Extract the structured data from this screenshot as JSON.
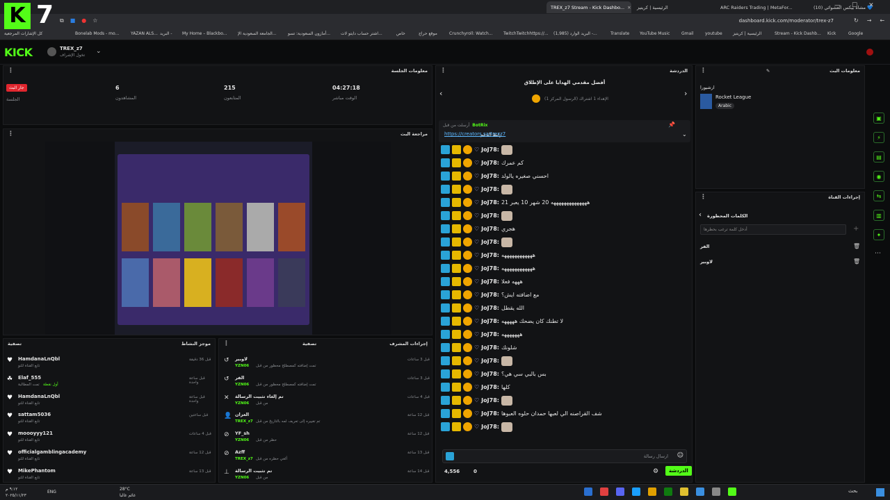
{
  "browser": {
    "tabs": [
      {
        "label": "(10) مشاه بيكس العشوائي 💙",
        "active": false
      },
      {
        "label": "ARC Raiders Trading | MetaFor...",
        "active": false
      },
      {
        "label": "الرئيسية | كريتيز",
        "active": false
      },
      {
        "label": "TREX_z7 Stream - Kick Dashbo...",
        "active": true
      },
      {
        "label": "",
        "active": false
      }
    ],
    "url": "dashboard.kick.com/moderator/trex-z7",
    "bookmarks": [
      "كل الإشارات المرجعية",
      "Bonelab Mods - mo...",
      "YAZAN ALS...",
      "البريد -",
      "My Home – Blackbo...",
      "الجامعة السعودية الإ...",
      "أمازون السعودية: تسو...",
      "اشتر حساب دايتو لات...",
      "خاص",
      "موقع حراج",
      "Crunchyroll: Watch...",
      "TwitchTwitchhttps://...",
      "(1,985) البريد الوارد -...",
      "Translate",
      "YouTube Music",
      "Gmail",
      "youtube",
      "الرئيسية | كريتيز",
      "Stream - Kick Dashb...",
      "Kick",
      "Google"
    ]
  },
  "kick": {
    "logo": "KICK",
    "channel_name": "TREX_z7",
    "channel_sub": "تخول الإشراف"
  },
  "session": {
    "title": "معلومات الجلسة",
    "live_badge": "جار البث",
    "live_label": "الجلسة",
    "viewers_value": "6",
    "viewers_label": "المشاهدون",
    "followers_value": "215",
    "followers_label": "المتابعون",
    "uptime_value": "04:27:18",
    "uptime_label": "الوقت مباشر"
  },
  "preview": {
    "title": "مراجعة البث"
  },
  "activity": {
    "title": "موجز النشاط",
    "filter": "تصفية",
    "items": [
      {
        "user": "HamdanaLnQbl",
        "action": "تابع القناة للتو",
        "time": "قبل 36 دقيقة",
        "icon": "heart"
      },
      {
        "user": "Elaf_555",
        "action": "تمت المطالبة",
        "extra": "أول نقطة",
        "time": "قبل ساعة واحدة",
        "icon": "reward"
      },
      {
        "user": "HamdanaLnQbl",
        "action": "تابع القناة للتو",
        "time": "قبل ساعة واحدة",
        "icon": "heart"
      },
      {
        "user": "sattam5036",
        "action": "تابع القناة للتو",
        "time": "قبل ساعتين",
        "icon": "heart"
      },
      {
        "user": "moooyyy121",
        "action": "تابع القناة للتو",
        "time": "قبل 4 ساعات",
        "icon": "heart"
      },
      {
        "user": "officialgamblingacademy",
        "action": "تابع القناة للتو",
        "time": "قبل 12 ساعة",
        "icon": "heart"
      },
      {
        "user": "MikePhantom",
        "action": "تابع القناة للتو",
        "time": "قبل 13 ساعة",
        "icon": "heart"
      }
    ]
  },
  "modactions": {
    "title": "إجراءات المشرف",
    "filter": "تصفية",
    "items": [
      {
        "title": "لاوبير",
        "detail": "تمت إضافته كمصطلح محظور من قبل",
        "by": "YZN06",
        "time": "قبل 3 ساعات",
        "icon": "undo"
      },
      {
        "title": "الفر",
        "detail": "تمت إضافته كمصطلح محظور من قبل",
        "by": "YZN06",
        "time": "قبل 3 ساعات",
        "icon": "undo"
      },
      {
        "title": "تم إلغاء تثبيت الرسالة",
        "detail": "من قبل",
        "by": "YZN06",
        "time": "قبل 4 ساعات",
        "icon": "unpin"
      },
      {
        "title": "العزان",
        "detail": "تم تغييره إلى تعريف لمه بالتاريخ من قبل",
        "by": "TREX_z7",
        "time": "قبل 12 ساعة",
        "icon": "user"
      },
      {
        "title": "YF_sh",
        "detail": "حظر من قبل",
        "by": "YZN06",
        "time": "قبل 12 ساعة",
        "icon": "ban"
      },
      {
        "title": "Azff",
        "detail": "ألغي حظره من قبل",
        "by": "TREX_z7",
        "time": "قبل 13 ساعة",
        "icon": "ban"
      },
      {
        "title": "تم تثبيت الرسالة",
        "detail": "من قبل",
        "by": "YZN06",
        "time": "قبل 14 ساعة",
        "icon": "pin"
      }
    ]
  },
  "chat": {
    "title": "الدردشة",
    "gifters_title": "أفضل مقدمي الهدايا على الإطلاق",
    "gifter_line": "الإهداء 1 اشتراك (الرسول المركز 1)",
    "pinned_by": "أرسلت من قبل",
    "pinned_user": "BotRix",
    "pinned_label": "رابط الدعم",
    "pinned_link": "https://creators.sa/trexz7",
    "messages": [
      {
        "user": "JoJ78:",
        "text": "",
        "emote": true
      },
      {
        "user": "JoJ78:",
        "text": "كم عمرك",
        "emote": false
      },
      {
        "user": "JoJ78:",
        "text": "احسني صغيره يالولد",
        "emote": false
      },
      {
        "user": "JoJ78:",
        "text": "",
        "emote": true
      },
      {
        "user": "JoJ78:",
        "text": "ههههههههههههههه 20 شهر 10 يعبر 21",
        "emote": false
      },
      {
        "user": "JoJ78:",
        "text": "",
        "emote": true
      },
      {
        "user": "JoJ78:",
        "text": "هجري",
        "emote": false
      },
      {
        "user": "JoJ78:",
        "text": "",
        "emote": true
      },
      {
        "user": "JoJ78:",
        "text": "ههههههههههههه",
        "emote": false
      },
      {
        "user": "JoJ78:",
        "text": "ههههههههههههه",
        "emote": false
      },
      {
        "user": "JoJ78:",
        "text": "هههه فعلا",
        "emote": false
      },
      {
        "user": "JoJ78:",
        "text": "مع اضافته ايش؟",
        "emote": false
      },
      {
        "user": "JoJ78:",
        "text": "الله يقطل",
        "emote": false
      },
      {
        "user": "JoJ78:",
        "text": "لا تطنك كان يضحك هههههه",
        "emote": false
      },
      {
        "user": "JoJ78:",
        "text": "هههههههه",
        "emote": false
      },
      {
        "user": "JoJ78:",
        "text": "شلونك",
        "emote": false
      },
      {
        "user": "JoJ78:",
        "text": "",
        "emote": true
      },
      {
        "user": "JoJ78:",
        "text": "بس بالبي سي هي؟",
        "emote": false
      },
      {
        "user": "JoJ78:",
        "text": "كلها",
        "emote": false
      },
      {
        "user": "JoJ78:",
        "text": "",
        "emote": true
      },
      {
        "user": "JoJ78:",
        "text": "شف القراصنه الي لعبها حمدان حلوه العبوها",
        "emote": false
      },
      {
        "user": "JoJ78:",
        "text": "",
        "emote": true
      }
    ],
    "input_placeholder": "ارسال رسالة",
    "points": "4,556",
    "count": "0",
    "send_label": "الدردشة"
  },
  "streaminfo": {
    "title": "معلومات البث",
    "category_label": "ارشيورا",
    "game": "Rocket League",
    "language": "Arabic"
  },
  "channelactions": {
    "title": "إجراءات القناة",
    "blocked_title": "الكلمات المحظورة",
    "input_placeholder": "أدخل كلمة ترغب بحظرها",
    "words": [
      "الفر",
      "لاوبير"
    ]
  },
  "taskbar": {
    "search": "بحث",
    "temp": "28°C",
    "weather": "غائم غالبا",
    "lang": "ENG",
    "time": "٩:١٢ م",
    "date": "٢٠٢٥/١١/٢٣"
  },
  "colors": {
    "accent": "#53fc18",
    "bg": "#0b0c0d",
    "panel": "#121315"
  }
}
